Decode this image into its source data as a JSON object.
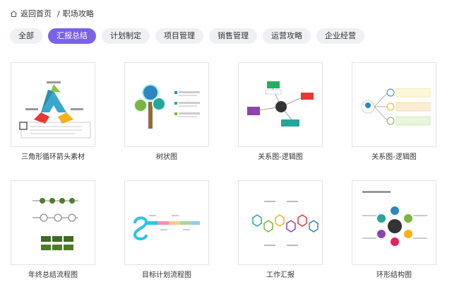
{
  "breadcrumb": {
    "home_label": "返回首页",
    "separator": "/",
    "current": "职场攻略"
  },
  "tabs": [
    {
      "label": "全部",
      "active": false
    },
    {
      "label": "汇报总结",
      "active": true
    },
    {
      "label": "计划制定",
      "active": false
    },
    {
      "label": "项目管理",
      "active": false
    },
    {
      "label": "销售管理",
      "active": false
    },
    {
      "label": "运营攻略",
      "active": false
    },
    {
      "label": "企业经营",
      "active": false
    }
  ],
  "cards": [
    {
      "title": "三角形循环箭头素材",
      "thumb": "triangle-cycle"
    },
    {
      "title": "树状图",
      "thumb": "tree"
    },
    {
      "title": "关系图-逻辑图",
      "thumb": "relation-map"
    },
    {
      "title": "关系图-逻辑图",
      "thumb": "logo-relation"
    },
    {
      "title": "年终总结流程图",
      "thumb": "year-end-flow"
    },
    {
      "title": "目标计划流程图",
      "thumb": "goal-flow"
    },
    {
      "title": "工作汇报",
      "thumb": "hexagons"
    },
    {
      "title": "环形结构图",
      "thumb": "ring-structure"
    }
  ],
  "colors": {
    "accent": "#7b61e8",
    "tab_bg": "#eef0f3",
    "border": "#e3e3e6"
  }
}
